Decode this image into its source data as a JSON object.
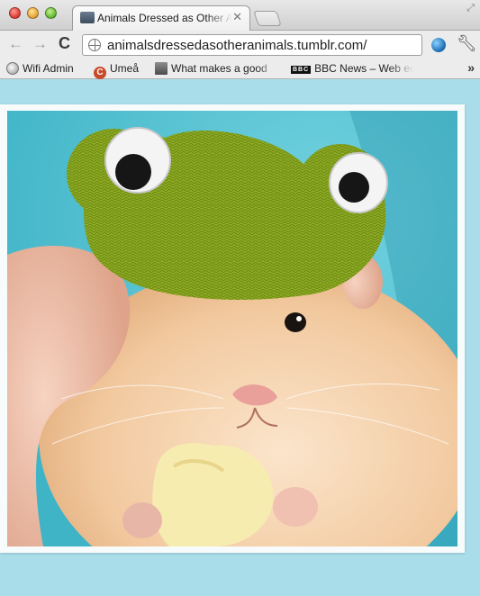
{
  "window": {
    "tab_title": "Animals Dressed as Other Animals",
    "tab_close": "✕"
  },
  "toolbar": {
    "url": "animalsdressedasotheranimals.tumblr.com/",
    "back_glyph": "←",
    "forward_glyph": "→",
    "reload_glyph": "C"
  },
  "bookmarks": {
    "items": [
      {
        "label": "Wifi Admin",
        "icon": "globe-icon"
      },
      {
        "label": "Umeå",
        "icon": "c-logo-icon",
        "icon_letter": "C"
      },
      {
        "label": "What makes a good",
        "icon": "avatar-icon"
      },
      {
        "label": "BBC News – Web eco",
        "icon": "bbc-icon",
        "icon_text": "BBC"
      }
    ],
    "more": "»"
  },
  "content": {
    "image": {
      "subject": "hamster-in-crocheted-frog-hat",
      "background_color": "#5fc9d8",
      "hat_color": "#93b12a"
    }
  },
  "colors": {
    "page_bg": "#a9dde9",
    "chrome_bg": "#ececec"
  }
}
